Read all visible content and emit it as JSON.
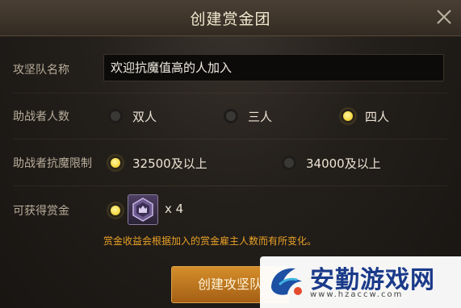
{
  "dialog": {
    "title": "创建赏金团"
  },
  "form": {
    "team_name": {
      "label": "攻坚队名称",
      "value": "欢迎抗魔值高的人加入"
    },
    "helper_count": {
      "label": "助战者人数",
      "options": [
        "双人",
        "三人",
        "四人"
      ],
      "selected": "四人"
    },
    "resist_limit": {
      "label": "助战者抗魔限制",
      "options": [
        "32500及以上",
        "34000及以上"
      ],
      "selected": "32500及以上"
    },
    "reward": {
      "label": "可获得赏金",
      "count": "x 4",
      "item_icon": "reward-chest-icon"
    },
    "note": "赏金收益会根据加入的赏金雇主人数而有所变化。"
  },
  "actions": {
    "create_label": "创建攻坚队"
  },
  "watermark": {
    "text": "安勤游戏网",
    "url": "www.hzaccw.com"
  },
  "colors": {
    "accent": "#e8a126",
    "selected_radio": "#f7dc4a",
    "button": "#c27a22"
  }
}
